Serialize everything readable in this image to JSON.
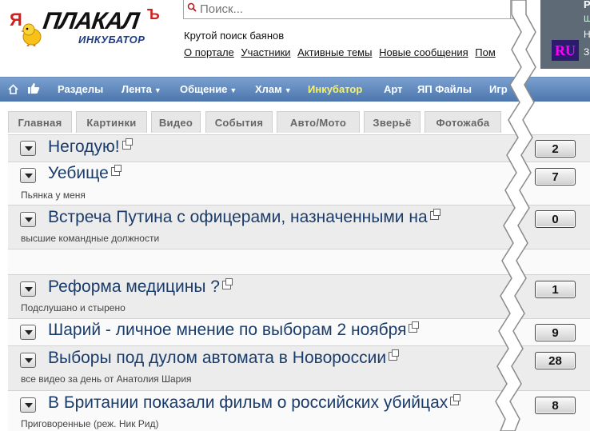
{
  "logo": {
    "ya": "Я",
    "name": "ПЛАКАЛ",
    "hard_sign": "Ъ",
    "subtitle": "ИНКУБАТОР"
  },
  "search": {
    "placeholder": "Поиск..."
  },
  "tagline": "Крутой поиск баянов",
  "top_links": [
    {
      "label": "О портале"
    },
    {
      "label": "Участники"
    },
    {
      "label": "Активные темы"
    },
    {
      "label": "Новые сообщения"
    },
    {
      "label": "Пом"
    }
  ],
  "user_panel": {
    "badge": "RU",
    "t1": "Р",
    "t2": "Ш",
    "t3": "Н",
    "t4": "З"
  },
  "nav": [
    {
      "label": "Разделы",
      "caret": false
    },
    {
      "label": "Лента",
      "caret": true
    },
    {
      "label": "Общение",
      "caret": true
    },
    {
      "label": "Хлам",
      "caret": true
    },
    {
      "label": "Инкубатор",
      "caret": false,
      "highlight": true
    },
    {
      "label": "Арт",
      "caret": false
    },
    {
      "label": "ЯП Файлы",
      "caret": false
    },
    {
      "label": "Игр",
      "caret": false
    }
  ],
  "tabs": [
    {
      "label": "Главная"
    },
    {
      "label": "Картинки"
    },
    {
      "label": "Видео"
    },
    {
      "label": "События"
    },
    {
      "label": "Авто/Мото"
    },
    {
      "label": "Зверьё"
    },
    {
      "label": "Фотожаба"
    }
  ],
  "topics": [
    {
      "title": "Негодую!",
      "subtitle": "",
      "count": "2"
    },
    {
      "title": "Уебище",
      "subtitle": "Пьянка у меня",
      "count": "7"
    },
    {
      "title": "Встреча Путина с офицерами, назначенными на",
      "subtitle": "высшие командные должности",
      "count": "0"
    },
    {
      "title": "",
      "subtitle": "",
      "count": ""
    },
    {
      "title": "Реформа медицины ?",
      "subtitle": "Подслушано и стырено",
      "count": "1"
    },
    {
      "title": "Шарий - личное мнение по выборам 2 ноября",
      "subtitle": "",
      "count": "9"
    },
    {
      "title": "Выборы под дулом автомата в Новороссии",
      "subtitle": "все видео за день от Анатолия Шария",
      "count": "28"
    },
    {
      "title": "В Британии показали фильм о российских убийцах",
      "subtitle": "Приговоренные (реж. Ник Рид)",
      "count": "8"
    }
  ]
}
